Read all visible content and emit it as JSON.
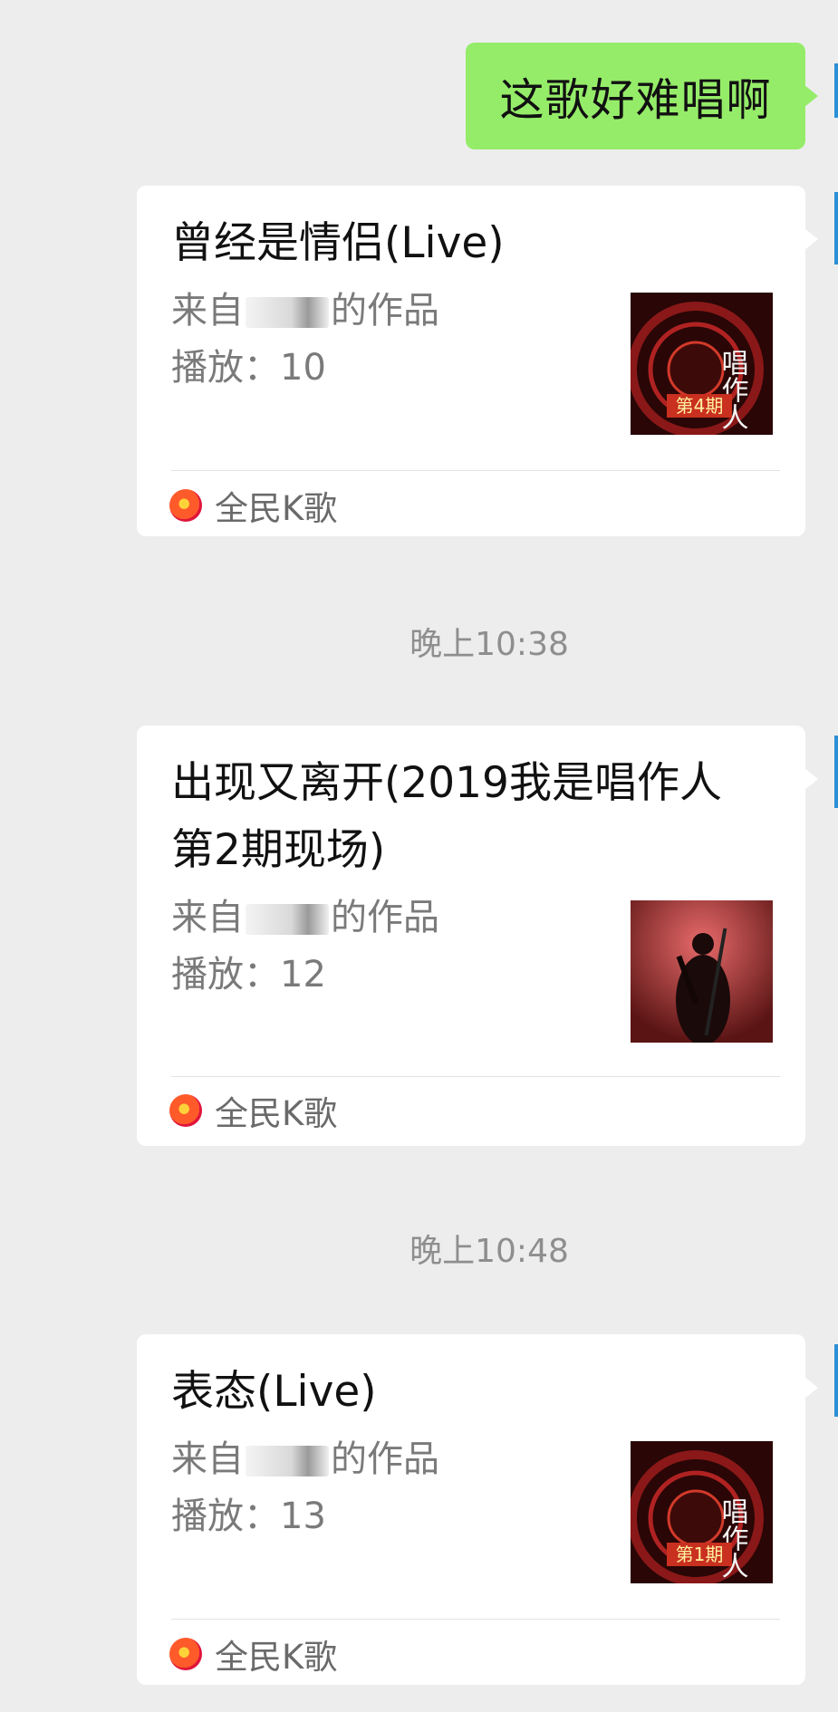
{
  "sent_message": "这歌好难唱啊",
  "cards": [
    {
      "title": "曾经是情侣(Live)",
      "from_prefix": "来自",
      "from_suffix": "的作品",
      "plays": "播放：10",
      "thumb_text": "唱作人",
      "thumb_badge": "第4期",
      "app": "全民K歌"
    },
    {
      "title": "出现又离开(2019我是唱作人第2期现场)",
      "from_prefix": "来自",
      "from_suffix": "的作品",
      "plays": "播放：12",
      "app": "全民K歌"
    },
    {
      "title": "表态(Live)",
      "from_prefix": "来自",
      "from_suffix": "的作品",
      "plays": "播放：13",
      "thumb_text": "唱作人",
      "thumb_badge": "第1期",
      "app": "全民K歌"
    }
  ],
  "timestamps": [
    "晚上10:38",
    "晚上10:48"
  ],
  "colors": {
    "background": "#ededed",
    "sent_bubble": "#95ec69",
    "card": "#ffffff",
    "app_icon": "#e0153b"
  }
}
